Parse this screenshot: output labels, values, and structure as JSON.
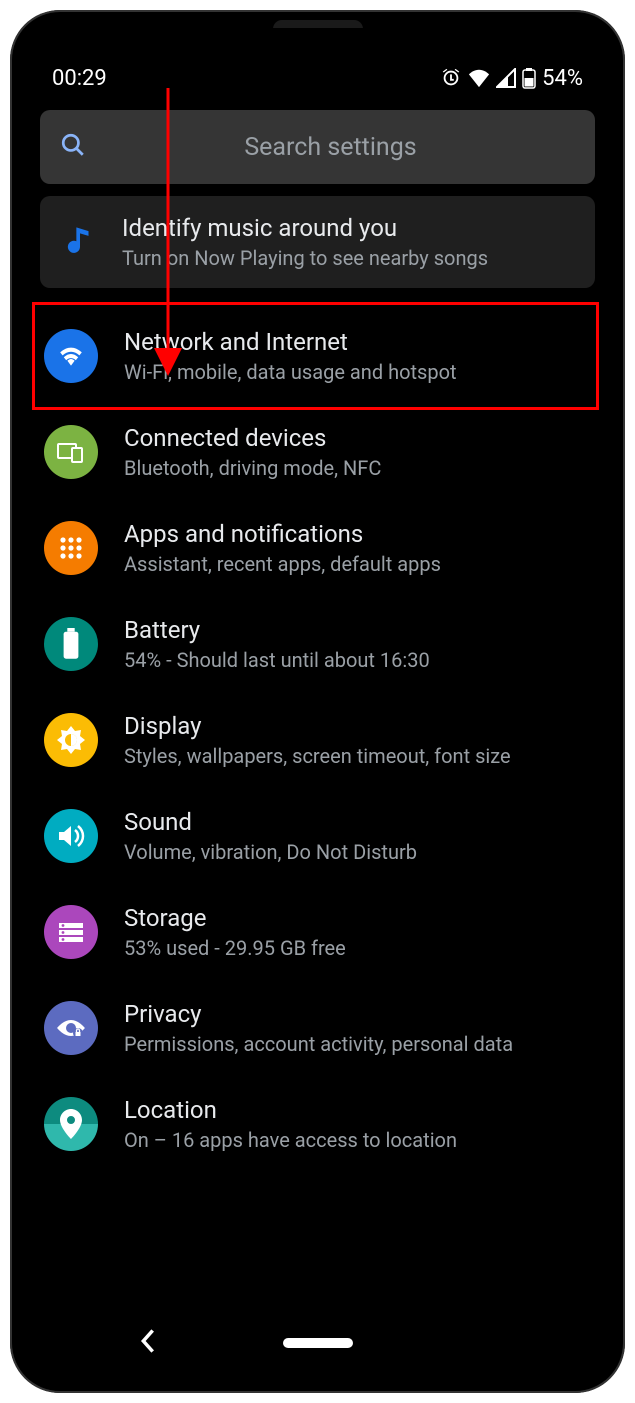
{
  "status": {
    "time": "00:29",
    "battery_text": "54%"
  },
  "search": {
    "placeholder": "Search settings"
  },
  "banner": {
    "title": "Identify music around you",
    "subtitle": "Turn on Now Playing to see nearby songs"
  },
  "items": [
    {
      "id": "network",
      "title": "Network and Internet",
      "subtitle": "Wi-Fi, mobile, data usage and hotspot",
      "color": "bg-blue",
      "icon": "wifi"
    },
    {
      "id": "connected",
      "title": "Connected devices",
      "subtitle": "Bluetooth, driving mode, NFC",
      "color": "bg-green",
      "icon": "devices"
    },
    {
      "id": "apps",
      "title": "Apps and notifications",
      "subtitle": "Assistant, recent apps, default apps",
      "color": "bg-orange",
      "icon": "apps"
    },
    {
      "id": "battery",
      "title": "Battery",
      "subtitle": "54% - Should last until about 16:30",
      "color": "bg-teal",
      "icon": "battery"
    },
    {
      "id": "display",
      "title": "Display",
      "subtitle": "Styles, wallpapers, screen timeout, font size",
      "color": "bg-amber",
      "icon": "brightness"
    },
    {
      "id": "sound",
      "title": "Sound",
      "subtitle": "Volume, vibration, Do Not Disturb",
      "color": "bg-cyan",
      "icon": "volume"
    },
    {
      "id": "storage",
      "title": "Storage",
      "subtitle": "53% used - 29.95 GB free",
      "color": "bg-purple",
      "icon": "storage"
    },
    {
      "id": "privacy",
      "title": "Privacy",
      "subtitle": "Permissions, account activity, personal data",
      "color": "bg-indigo",
      "icon": "privacy"
    },
    {
      "id": "location",
      "title": "Location",
      "subtitle": "On – 16 apps have access to location",
      "color": "bg-tealgrad",
      "icon": "location"
    }
  ],
  "annotation": {
    "highlighted_item_id": "network"
  }
}
